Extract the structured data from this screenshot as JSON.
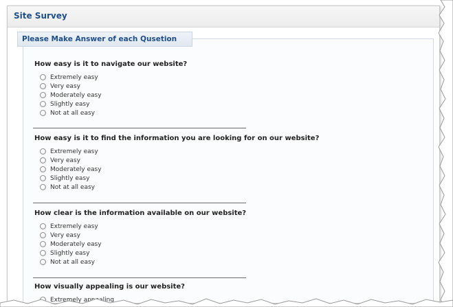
{
  "page": {
    "title": "Site Survey",
    "section_title": "Please Make Answer of each Qusetion"
  },
  "questions": [
    {
      "text": "How easy is it to navigate our website?",
      "options": [
        "Extremely easy",
        "Very easy",
        "Moderately easy",
        "Slightly easy",
        "Not at all easy"
      ]
    },
    {
      "text": "How easy is it to find the information you are looking for on our website?",
      "options": [
        "Extremely easy",
        "Very easy",
        "Moderately easy",
        "Slightly easy",
        "Not at all easy"
      ]
    },
    {
      "text": "How clear is the information available on our website?",
      "options": [
        "Extremely easy",
        "Very easy",
        "Moderately easy",
        "Slightly easy",
        "Not at all easy"
      ]
    },
    {
      "text": "How visually appealing is our website?",
      "options": [
        "Extremely appealing"
      ]
    }
  ],
  "colors": {
    "title": "#1f4e8c",
    "legend_bg": "#e7eef6"
  }
}
